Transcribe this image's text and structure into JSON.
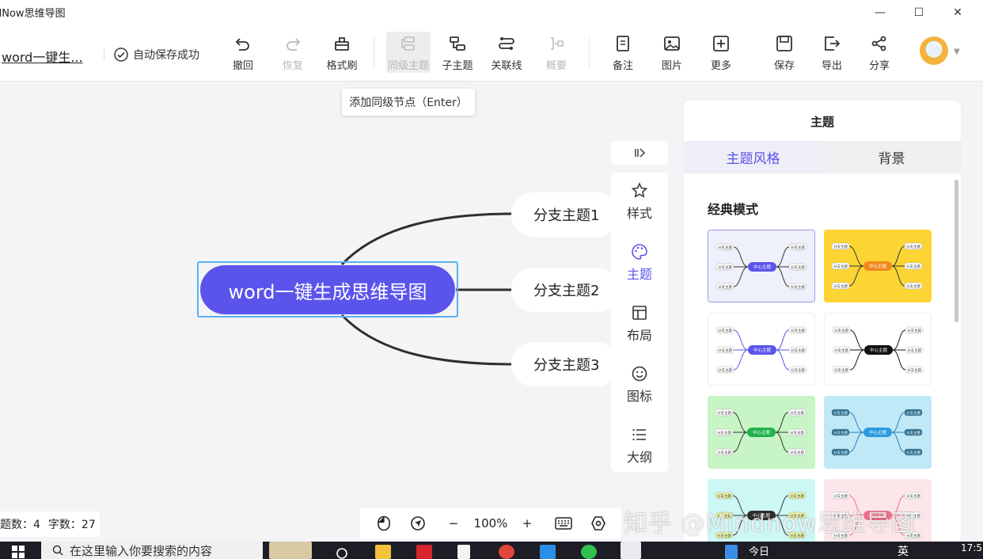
{
  "window": {
    "title": "dNow思维导图",
    "controls": [
      "—",
      "☐",
      "✕"
    ]
  },
  "toolbar": {
    "doc_name": "word一键生...",
    "autosave": "自动保存成功",
    "tools": {
      "undo": "撤回",
      "redo": "恢复",
      "format_brush": "格式刷",
      "sibling": "同级主题",
      "child": "子主题",
      "relation": "关联线",
      "summary": "概要",
      "note": "备注",
      "image": "图片",
      "more": "更多",
      "save": "保存",
      "export": "导出",
      "share": "分享"
    }
  },
  "tooltip": "添加同级节点（Enter）",
  "mindmap": {
    "center": "word一键生成思维导图",
    "branches": [
      "分支主题1",
      "分支主题2",
      "分支主题3"
    ]
  },
  "sidenav": {
    "items": [
      "样式",
      "主题",
      "布局",
      "图标",
      "大纲"
    ],
    "active": "主题"
  },
  "panel": {
    "title": "主题",
    "tabs": [
      "主题风格",
      "背景"
    ],
    "section": "经典模式",
    "card_center_label": "中心主题",
    "card_branch_label": "分支主题",
    "card_colors": [
      "#eef0fb",
      "#fcd535",
      "#ffffff",
      "#ffffff",
      "#c7f5c5",
      "#bfe9f7",
      "#cdf7f5",
      "#fde6ea"
    ]
  },
  "status": {
    "topics": "题数：4",
    "words": "字数：27"
  },
  "zoom": {
    "minus": "−",
    "level": "100%",
    "plus": "+"
  },
  "watermark": "知乎 @Mindnow思维导图",
  "taskbar": {
    "search_placeholder": "在这里输入你要搜索的内容",
    "weather": "今日",
    "ime": "英",
    "clock": "17:5"
  }
}
